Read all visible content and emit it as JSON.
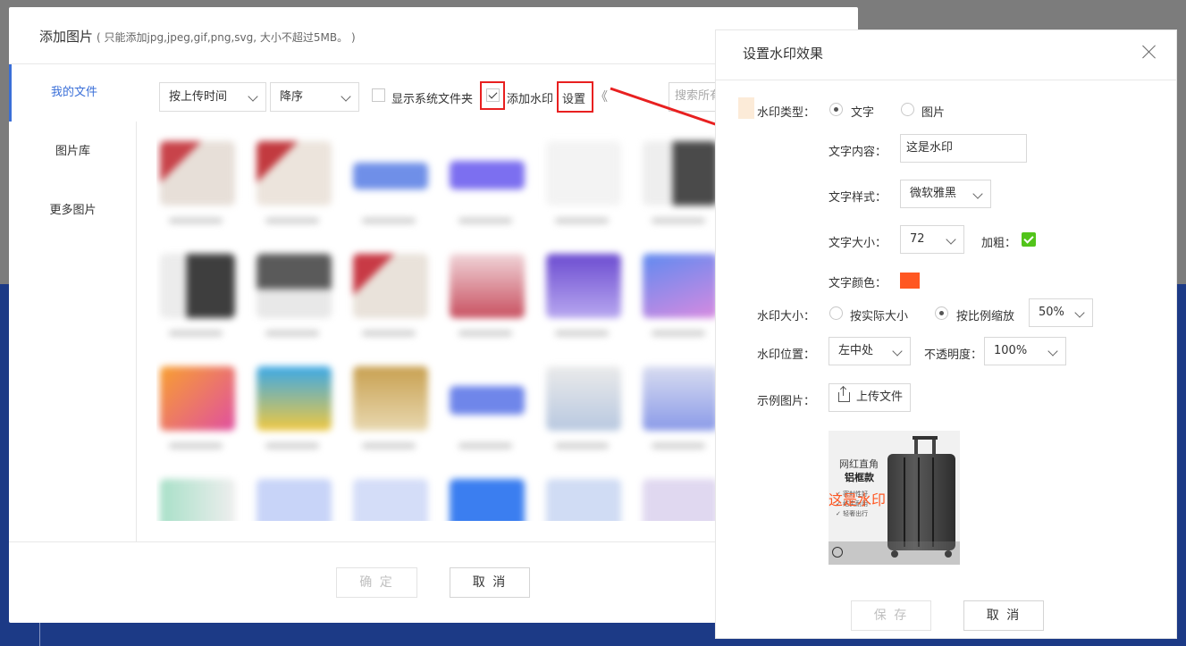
{
  "dialog": {
    "title": "添加图片",
    "subtitle": "( 只能添加jpg,jpeg,gif,png,svg, 大小不超过5MB。 )"
  },
  "sidebar": {
    "items": [
      {
        "label": "我的文件",
        "active": true
      },
      {
        "label": "图片库",
        "active": false
      },
      {
        "label": "更多图片",
        "active": false
      }
    ]
  },
  "toolbar": {
    "sort_by": "按上传时间",
    "order": "降序",
    "show_system_folders_label": "显示系统文件夹",
    "show_system_folders_checked": false,
    "add_watermark_label": "添加水印",
    "add_watermark_checked": true,
    "settings_label": "设置",
    "collapse_glyph": "《",
    "search_placeholder": "搜索所有"
  },
  "footer": {
    "confirm_label": "确 定",
    "cancel_label": "取 消"
  },
  "watermark_panel": {
    "title": "设置水印效果",
    "type_label": "水印类型：",
    "type_options": [
      {
        "label": "文字",
        "selected": true
      },
      {
        "label": "图片",
        "selected": false
      }
    ],
    "text_content_label": "文字内容：",
    "text_content_value": "这是水印",
    "text_style_label": "文字样式：",
    "text_style_value": "微软雅黑",
    "text_size_label": "文字大小：",
    "text_size_value": "72",
    "bold_label": "加粗：",
    "bold_checked": true,
    "text_color_label": "文字颜色：",
    "text_color": "#ff5722",
    "size_label": "水印大小：",
    "size_options": [
      {
        "label": "按实际大小",
        "selected": false
      },
      {
        "label": "按比例缩放",
        "selected": true
      }
    ],
    "scale_value": "50%",
    "position_label": "水印位置：",
    "position_value": "左中处",
    "opacity_label": "不透明度：",
    "opacity_value": "100%",
    "sample_label": "示例图片：",
    "upload_label": "上传文件",
    "sample_image": {
      "line1": "网红直角",
      "line2": "铝框款",
      "features": [
        "✓ 密封性好",
        "✓ 结实耐用",
        "✓ 轻奢出行"
      ],
      "watermark_text": "这是水印"
    },
    "save_label": "保 存",
    "cancel_label": "取 消"
  },
  "colors": {
    "accent": "#3a6fd8",
    "annotation_red": "#e82020",
    "check_green": "#52c41a",
    "backdrop_blue": "#1c3a86"
  }
}
